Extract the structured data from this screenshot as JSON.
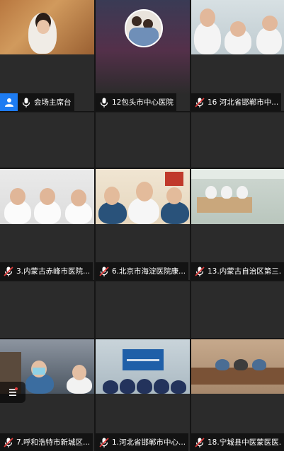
{
  "participants": [
    {
      "label": "会场主席台",
      "host": true,
      "muted": false
    },
    {
      "label": "12包头市中心医院",
      "host": false,
      "muted": false
    },
    {
      "label": "16  河北省邯郸市中...",
      "host": false,
      "muted": true
    },
    {
      "label": "",
      "host": false,
      "muted": false
    },
    {
      "label": "",
      "host": false,
      "muted": false
    },
    {
      "label": "",
      "host": false,
      "muted": false
    },
    {
      "label": "3.内蒙古赤峰市医院...",
      "host": false,
      "muted": true
    },
    {
      "label": "6.北京市海淀医院康...",
      "host": false,
      "muted": true
    },
    {
      "label": "13.内蒙古自治区第三...",
      "host": false,
      "muted": true
    },
    {
      "label": "",
      "host": false,
      "muted": false
    },
    {
      "label": "",
      "host": false,
      "muted": false
    },
    {
      "label": "",
      "host": false,
      "muted": false
    },
    {
      "label": "7.呼和浩特市新城区...",
      "host": false,
      "muted": true
    },
    {
      "label": "1.河北省邯郸市中心...",
      "host": false,
      "muted": true
    },
    {
      "label": "18.宁城县中医蒙医医...",
      "host": false,
      "muted": true
    }
  ],
  "colors": {
    "tile_bg": "#2b2b2b",
    "host_badge": "#1e7cf2",
    "muted_red": "#e03b3b"
  },
  "icons": {
    "mic": "microphone-icon",
    "mic_muted": "microphone-muted-icon",
    "host": "person-icon",
    "panel": "list-icon"
  }
}
